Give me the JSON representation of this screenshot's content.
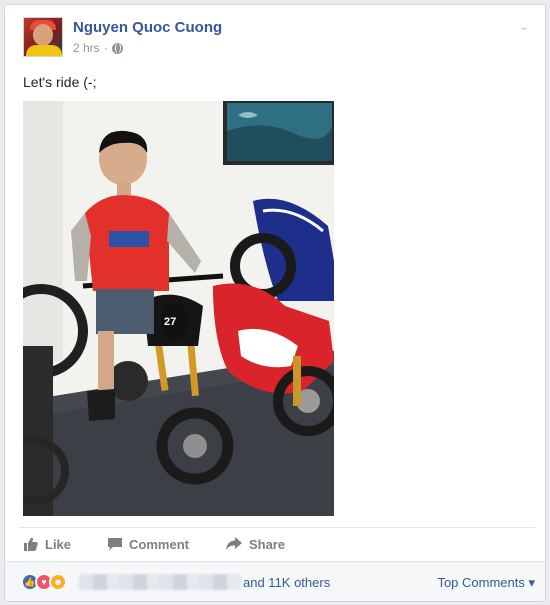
{
  "post": {
    "author": "Nguyen Quoc Cuong",
    "time": "2 hrs",
    "separator": "·",
    "privacy_icon": "globe-icon",
    "text": "Let's ride (-;"
  },
  "actions": {
    "like": "Like",
    "comment": "Comment",
    "share": "Share"
  },
  "reactions": {
    "icons": [
      "like-icon",
      "love-icon",
      "haha-icon"
    ],
    "others": "and 11K others",
    "top_comments": "Top Comments ▾"
  },
  "colors": {
    "link": "#365899",
    "muted": "#90949c",
    "action": "#7f7f7f",
    "like_reaction": "#4267b2",
    "love_reaction": "#f25268",
    "haha_reaction": "#f7b125"
  }
}
